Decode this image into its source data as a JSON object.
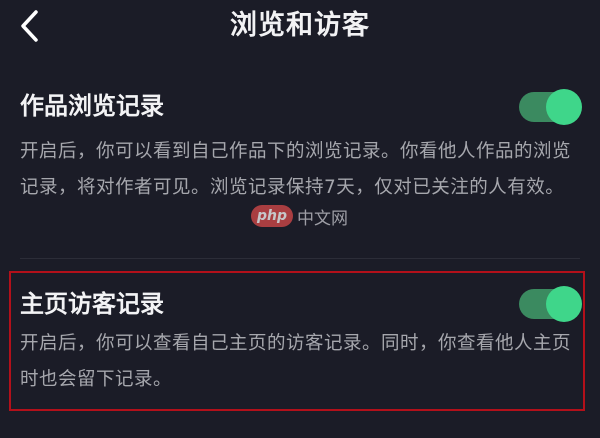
{
  "header": {
    "back_icon": "chevron-left-icon",
    "title": "浏览和访客"
  },
  "works_browse_record": {
    "title": "作品浏览记录",
    "description": "开启后，你可以看到自己作品下的浏览记录。你看他人作品的浏览记录，将对作者可见。浏览记录保持7天，仅对已关注的人有效。",
    "toggle_on": true
  },
  "homepage_visitor_record": {
    "title": "主页访客记录",
    "description": "开启后，你可以查看自己主页的访客记录。同时，你查看他人主页时也会留下记录。",
    "toggle_on": true
  },
  "watermark": {
    "badge": "php",
    "text": "中文网"
  },
  "colors": {
    "background": "#1b1c27",
    "toggle_track": "#3b8a60",
    "toggle_knob": "#3fd68a",
    "highlight_border": "#b3101a",
    "description_text": "#a6a7ad"
  }
}
